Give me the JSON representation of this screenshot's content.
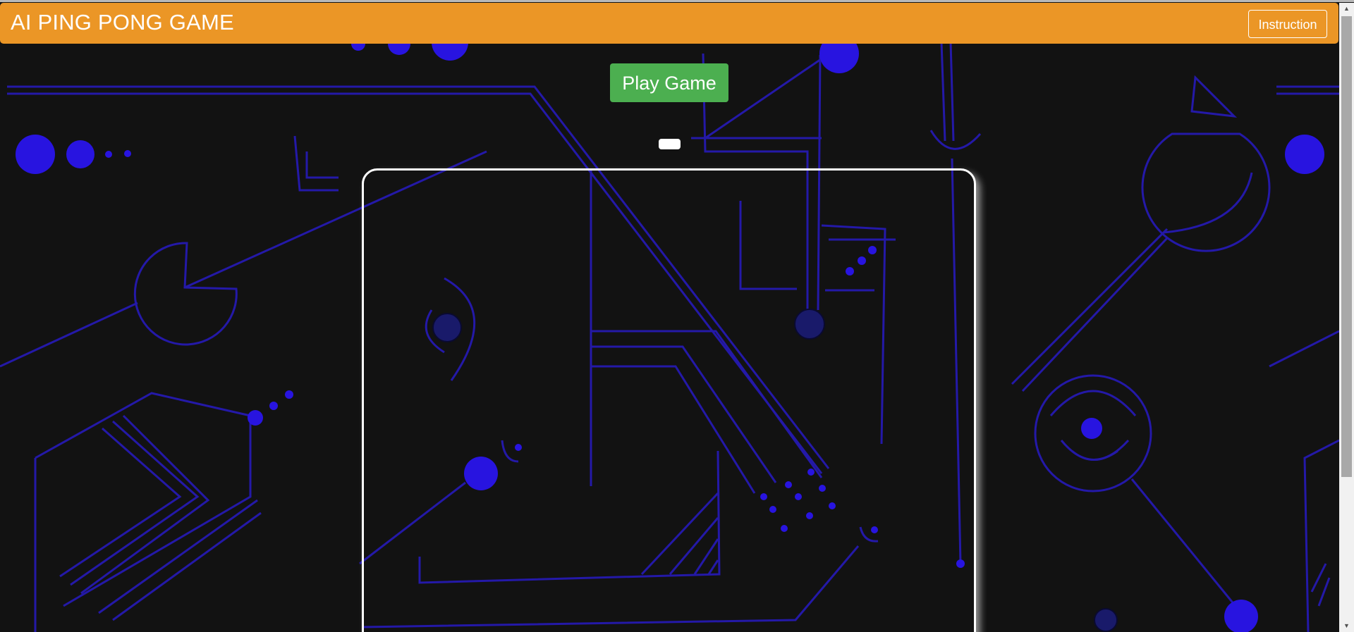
{
  "navbar": {
    "title": "AI PING PONG GAME",
    "instruction_label": "Instruction",
    "color": "#eb9626"
  },
  "controls": {
    "play_label": "Play Game",
    "play_color": "#4caf50"
  },
  "scrollbar": {
    "up_icon": "triangle-up-icon",
    "down_icon": "triangle-down-icon"
  },
  "theme": {
    "background": "#121212",
    "circuit_line": "#2a1fb0",
    "circuit_dot": "#2a14e0",
    "board_border": "#ffffff"
  }
}
